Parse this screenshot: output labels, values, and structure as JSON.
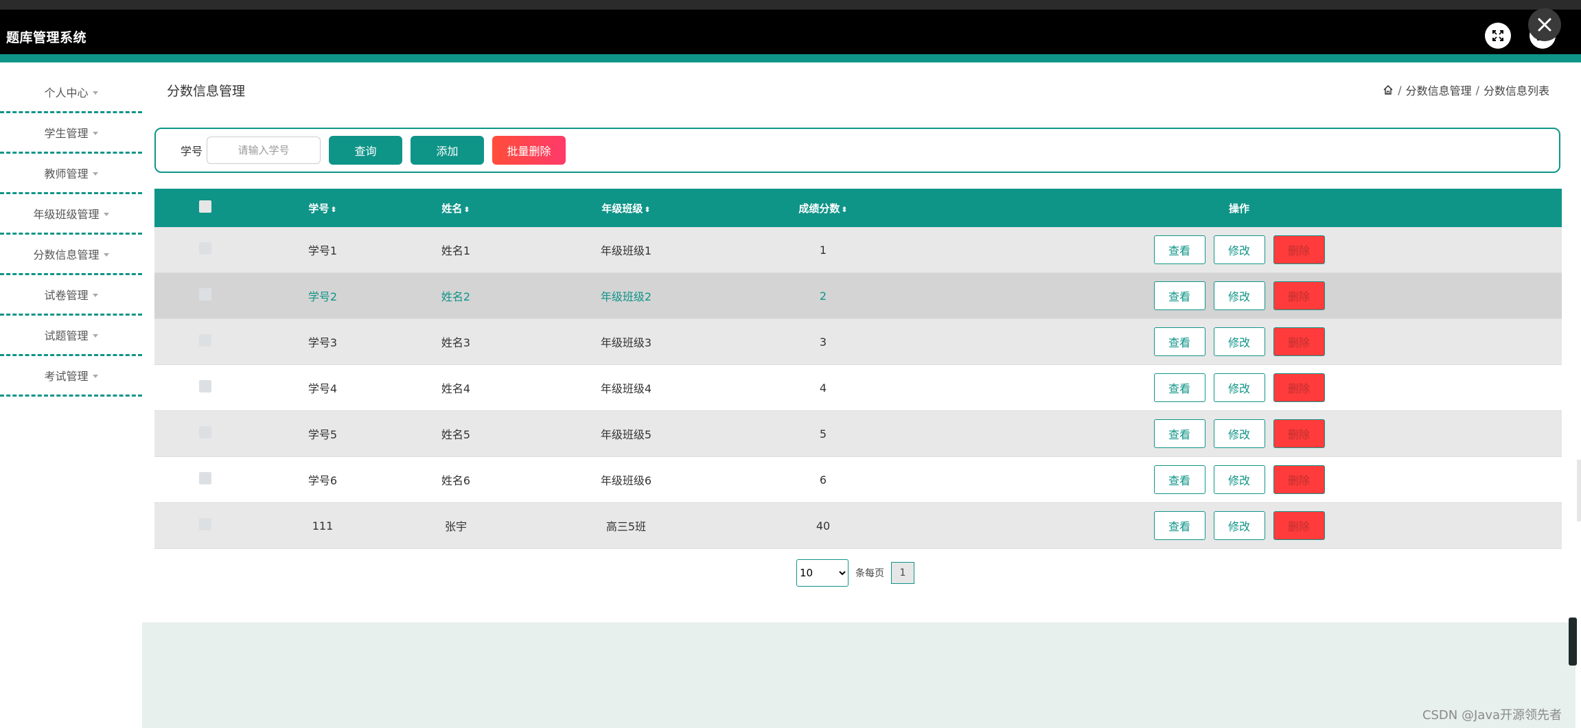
{
  "app": {
    "title": "题库管理系统"
  },
  "header": {
    "fullscreen_icon": "expand-icon",
    "window_icon": "window-icon",
    "close_icon": "close-icon"
  },
  "sidebar": {
    "items": [
      {
        "label": "个人中心"
      },
      {
        "label": "学生管理"
      },
      {
        "label": "教师管理"
      },
      {
        "label": "年级班级管理"
      },
      {
        "label": "分数信息管理"
      },
      {
        "label": "试卷管理"
      },
      {
        "label": "试题管理"
      },
      {
        "label": "考试管理"
      }
    ]
  },
  "page": {
    "title": "分数信息管理",
    "breadcrumb": [
      "分数信息管理",
      "分数信息列表"
    ],
    "breadcrumb_sep": "/"
  },
  "search": {
    "label": "学号",
    "placeholder": "请输入学号",
    "query_label": "查询",
    "add_label": "添加",
    "batch_delete_label": "批量删除"
  },
  "table": {
    "columns": [
      "学号",
      "姓名",
      "年级班级",
      "成绩分数",
      "操作"
    ],
    "sort_glyph": "⬍",
    "rows": [
      {
        "id": "学号1",
        "name": "姓名1",
        "class": "年级班级1",
        "score": "1"
      },
      {
        "id": "学号2",
        "name": "姓名2",
        "class": "年级班级2",
        "score": "2"
      },
      {
        "id": "学号3",
        "name": "姓名3",
        "class": "年级班级3",
        "score": "3"
      },
      {
        "id": "学号4",
        "name": "姓名4",
        "class": "年级班级4",
        "score": "4"
      },
      {
        "id": "学号5",
        "name": "姓名5",
        "class": "年级班级5",
        "score": "5"
      },
      {
        "id": "学号6",
        "name": "姓名6",
        "class": "年级班级6",
        "score": "6"
      },
      {
        "id": "111",
        "name": "张宇",
        "class": "高三5班",
        "score": "40"
      }
    ],
    "actions": {
      "view": "查看",
      "edit": "修改",
      "delete": "删除"
    }
  },
  "pager": {
    "page_size": "10",
    "per_page_label": "条每页",
    "current_page": "1"
  },
  "watermark": "CSDN @Java开源领先者"
}
